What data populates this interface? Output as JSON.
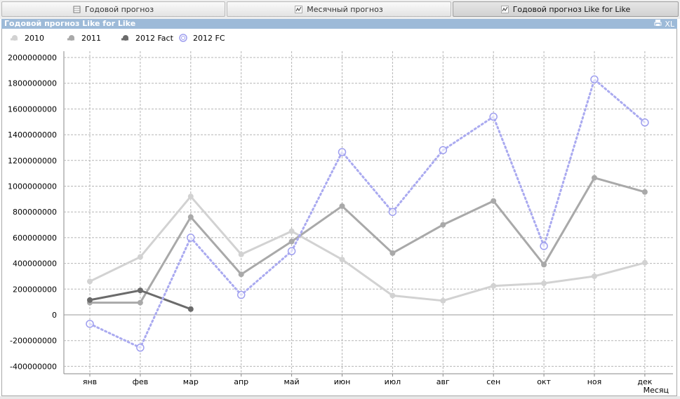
{
  "tabs": [
    {
      "label": "Годовой прогноз",
      "icon": "table-icon",
      "active": false
    },
    {
      "label": "Месячный прогноз",
      "icon": "line-chart-icon",
      "active": false
    },
    {
      "label": "Годовой прогноз Like for Like",
      "icon": "line-chart-icon",
      "active": true
    }
  ],
  "panel": {
    "title": "Годовой прогноз Like for Like",
    "print_icon": "print-icon",
    "xl_label": "XL"
  },
  "chart_data": {
    "type": "line",
    "title": "",
    "xlabel": "Месяц",
    "ylabel": "",
    "categories": [
      "янв",
      "фев",
      "мар",
      "апр",
      "май",
      "июн",
      "июл",
      "авг",
      "сен",
      "окт",
      "ноя",
      "дек"
    ],
    "ylim": [
      -450000000,
      2050000000
    ],
    "yticks": [
      -400000000,
      -200000000,
      0,
      200000000,
      400000000,
      600000000,
      800000000,
      1000000000,
      1200000000,
      1400000000,
      1600000000,
      1800000000,
      2000000000
    ],
    "grid": true,
    "legend_position": "top-left",
    "series": [
      {
        "name": "2010",
        "color": "#d2d2d2",
        "style": "solid",
        "marker": "dot",
        "values": [
          260000000,
          450000000,
          920000000,
          470000000,
          650000000,
          430000000,
          150000000,
          110000000,
          225000000,
          245000000,
          300000000,
          405000000
        ]
      },
      {
        "name": "2011",
        "color": "#a9a9a9",
        "style": "solid",
        "marker": "dot",
        "values": [
          95000000,
          95000000,
          760000000,
          315000000,
          570000000,
          845000000,
          480000000,
          700000000,
          885000000,
          390000000,
          1065000000,
          955000000
        ]
      },
      {
        "name": "2012 Fact",
        "color": "#6b6b6b",
        "style": "solid",
        "marker": "dot",
        "values": [
          115000000,
          190000000,
          45000000,
          null,
          null,
          null,
          null,
          null,
          null,
          null,
          null,
          null
        ]
      },
      {
        "name": "2012 FC",
        "color": "#aaaaf0",
        "style": "dotted",
        "marker": "ring",
        "values": [
          -70000000,
          -255000000,
          600000000,
          155000000,
          495000000,
          1265000000,
          800000000,
          1280000000,
          1540000000,
          535000000,
          1830000000,
          1495000000
        ]
      }
    ]
  }
}
